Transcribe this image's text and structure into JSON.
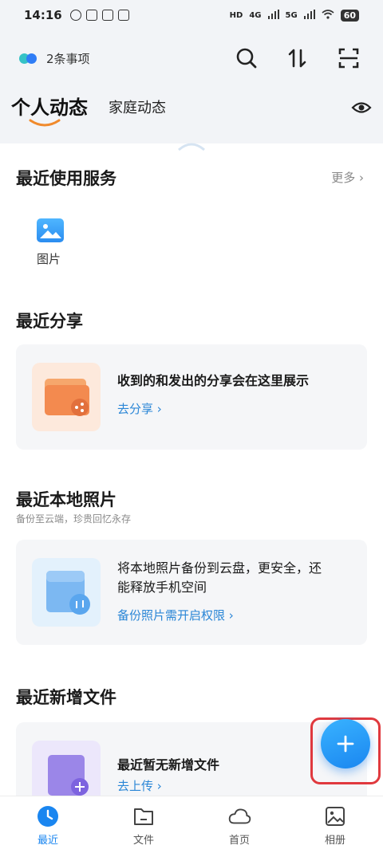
{
  "status_bar": {
    "time": "14:16",
    "network_labels": [
      "HD",
      "4G",
      "5G"
    ],
    "battery": "60"
  },
  "header": {
    "pending_text": "2条事项",
    "icons": [
      "search-icon",
      "sort-icon",
      "scan-icon"
    ]
  },
  "tabs": {
    "active": "个人动态",
    "other": "家庭动态",
    "eye_icon": "eye-icon"
  },
  "recent_services": {
    "title": "最近使用服务",
    "more": "更多",
    "items": [
      {
        "label": "图片",
        "icon": "image-icon"
      }
    ]
  },
  "recent_share": {
    "title": "最近分享",
    "card_text": "收到的和发出的分享会在这里展示",
    "link": "去分享"
  },
  "local_photos": {
    "title": "最近本地照片",
    "subtitle": "备份至云端，珍贵回忆永存",
    "card_text_line1": "将本地照片备份到云盘，更安全，还",
    "card_text_line2": "能释放手机空间",
    "link": "备份照片需开启权限"
  },
  "recent_files": {
    "title": "最近新增文件",
    "card_text": "最近暂无新增文件",
    "link": "去上传"
  },
  "fab": {
    "icon": "plus-icon"
  },
  "bottom_nav": [
    {
      "label": "最近",
      "icon": "clock-icon",
      "active": true
    },
    {
      "label": "文件",
      "icon": "folder-icon",
      "active": false
    },
    {
      "label": "首页",
      "icon": "cloud-icon",
      "active": false
    },
    {
      "label": "相册",
      "icon": "album-icon",
      "active": false
    }
  ],
  "colors": {
    "accent": "#1a86f0",
    "link": "#2a86d6",
    "highlight_box": "#e0393e",
    "card_bg": "#f5f6f8"
  }
}
